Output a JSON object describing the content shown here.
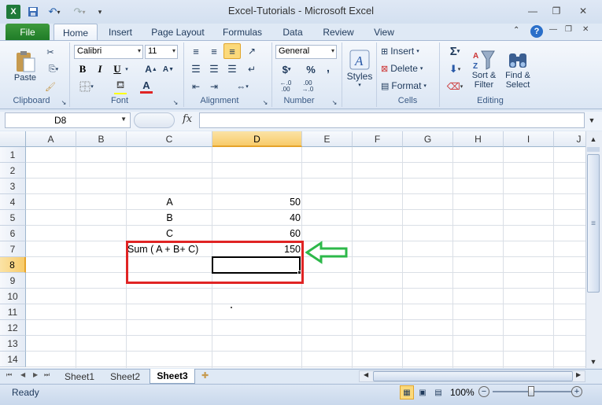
{
  "window": {
    "title": "Excel-Tutorials - Microsoft Excel"
  },
  "qat": {
    "save_icon": "save-icon",
    "undo_icon": "undo-icon",
    "redo_icon": "redo-icon"
  },
  "tabs": [
    {
      "label": "File"
    },
    {
      "label": "Home"
    },
    {
      "label": "Insert"
    },
    {
      "label": "Page Layout"
    },
    {
      "label": "Formulas"
    },
    {
      "label": "Data"
    },
    {
      "label": "Review"
    },
    {
      "label": "View"
    }
  ],
  "ribbon": {
    "clipboard": {
      "label": "Clipboard",
      "paste": "Paste"
    },
    "font": {
      "label": "Font",
      "name": "Calibri",
      "size": "11",
      "bold": "B",
      "italic": "I",
      "underline": "U"
    },
    "alignment": {
      "label": "Alignment"
    },
    "number": {
      "label": "Number",
      "format": "General",
      "currency": "$",
      "percent": "%",
      "comma": ","
    },
    "styles": {
      "label": "Styles"
    },
    "cells": {
      "label": "Cells",
      "insert": "Insert",
      "delete": "Delete",
      "format": "Format"
    },
    "editing": {
      "label": "Editing",
      "sum": "Σ",
      "sort1": "Sort &",
      "sort2": "Filter",
      "find1": "Find &",
      "find2": "Select"
    }
  },
  "formula_bar": {
    "name_box": "D8",
    "fx": "fx",
    "value": ""
  },
  "columns": [
    "A",
    "B",
    "C",
    "D",
    "E",
    "F",
    "G",
    "H",
    "I",
    "J"
  ],
  "rows": [
    "1",
    "2",
    "3",
    "4",
    "5",
    "6",
    "7",
    "8",
    "9",
    "10",
    "11",
    "12",
    "13",
    "14"
  ],
  "cells": {
    "c4": "A",
    "d4": "50",
    "c5": "B",
    "d5": "40",
    "c6": "C",
    "d6": "60",
    "c7": "Sum ( A + B+ C)",
    "d7": "150"
  },
  "sheets": [
    {
      "label": "Sheet1"
    },
    {
      "label": "Sheet2"
    },
    {
      "label": "Sheet3"
    }
  ],
  "status": {
    "ready": "Ready",
    "zoom": "100%"
  },
  "colors": {
    "highlight_box": "#e02424",
    "arrow": "#2db84a",
    "selected_header": "#f8cb6a",
    "file_tab": "#2a8a30"
  }
}
